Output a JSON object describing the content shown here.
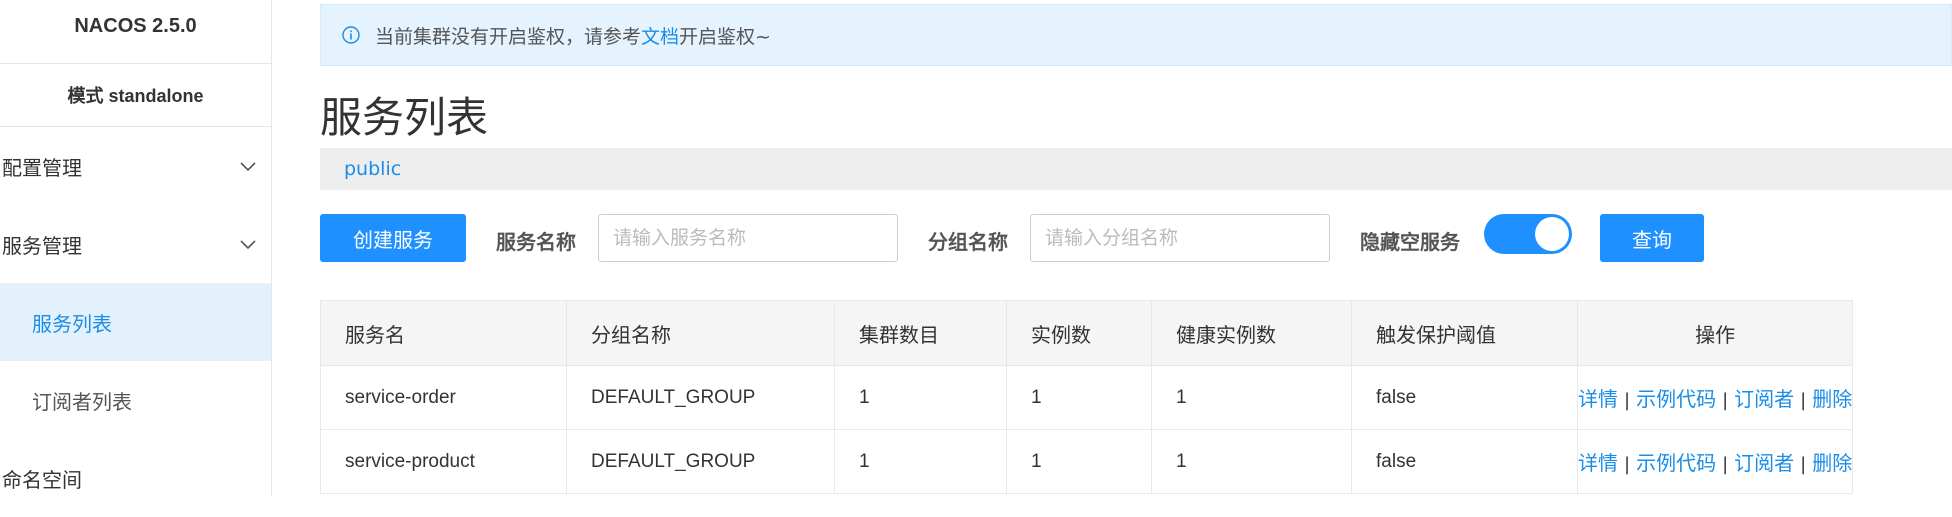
{
  "sidebar": {
    "brand": "NACOS 2.5.0",
    "mode": "模式 standalone",
    "groups": [
      {
        "label": "配置管理"
      },
      {
        "label": "服务管理"
      }
    ],
    "service_items": [
      {
        "label": "服务列表"
      },
      {
        "label": "订阅者列表"
      }
    ],
    "namespace": "命名空间"
  },
  "alert": {
    "text_before": "当前集群没有开启鉴权，请参考",
    "link": "文档",
    "text_after": "开启鉴权~"
  },
  "page": {
    "title": "服务列表",
    "namespace": "public"
  },
  "toolbar": {
    "create_label": "创建服务",
    "service_name_label": "服务名称",
    "service_name_placeholder": "请输入服务名称",
    "group_name_label": "分组名称",
    "group_name_placeholder": "请输入分组名称",
    "hide_empty_label": "隐藏空服务",
    "hide_empty_on": true,
    "query_label": "查询"
  },
  "table": {
    "headers": [
      "服务名",
      "分组名称",
      "集群数目",
      "实例数",
      "健康实例数",
      "触发保护阈值",
      "操作"
    ],
    "rows": [
      {
        "name": "service-order",
        "group": "DEFAULT_GROUP",
        "clusters": "1",
        "instances": "1",
        "healthy": "1",
        "threshold": "false"
      },
      {
        "name": "service-product",
        "group": "DEFAULT_GROUP",
        "clusters": "1",
        "instances": "1",
        "healthy": "1",
        "threshold": "false"
      }
    ],
    "actions": {
      "detail": "详情",
      "sample": "示例代码",
      "subscribers": "订阅者",
      "delete": "删除",
      "separator": "|"
    }
  },
  "colors": {
    "primary": "#1e90ff",
    "link": "#1b8de6",
    "active_bg": "#e3f1fd",
    "alert_bg": "#e5f3fe"
  }
}
